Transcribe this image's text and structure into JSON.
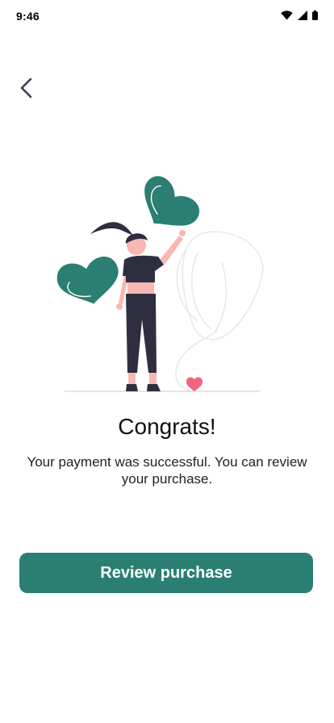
{
  "status_bar": {
    "time": "9:46",
    "icons": [
      "wifi-icon",
      "cellular-signal-icon",
      "battery-icon"
    ]
  },
  "navigation": {
    "back_icon": "chevron-left-icon"
  },
  "content": {
    "title": "Congrats!",
    "message": "Your payment was successful. You can review your purchase."
  },
  "actions": {
    "primary_label": "Review purchase"
  },
  "colors": {
    "accent": "#2a7f72",
    "heart_pink": "#f2657e",
    "figure_dark": "#2f2e41",
    "skin": "#f9b7b3"
  }
}
